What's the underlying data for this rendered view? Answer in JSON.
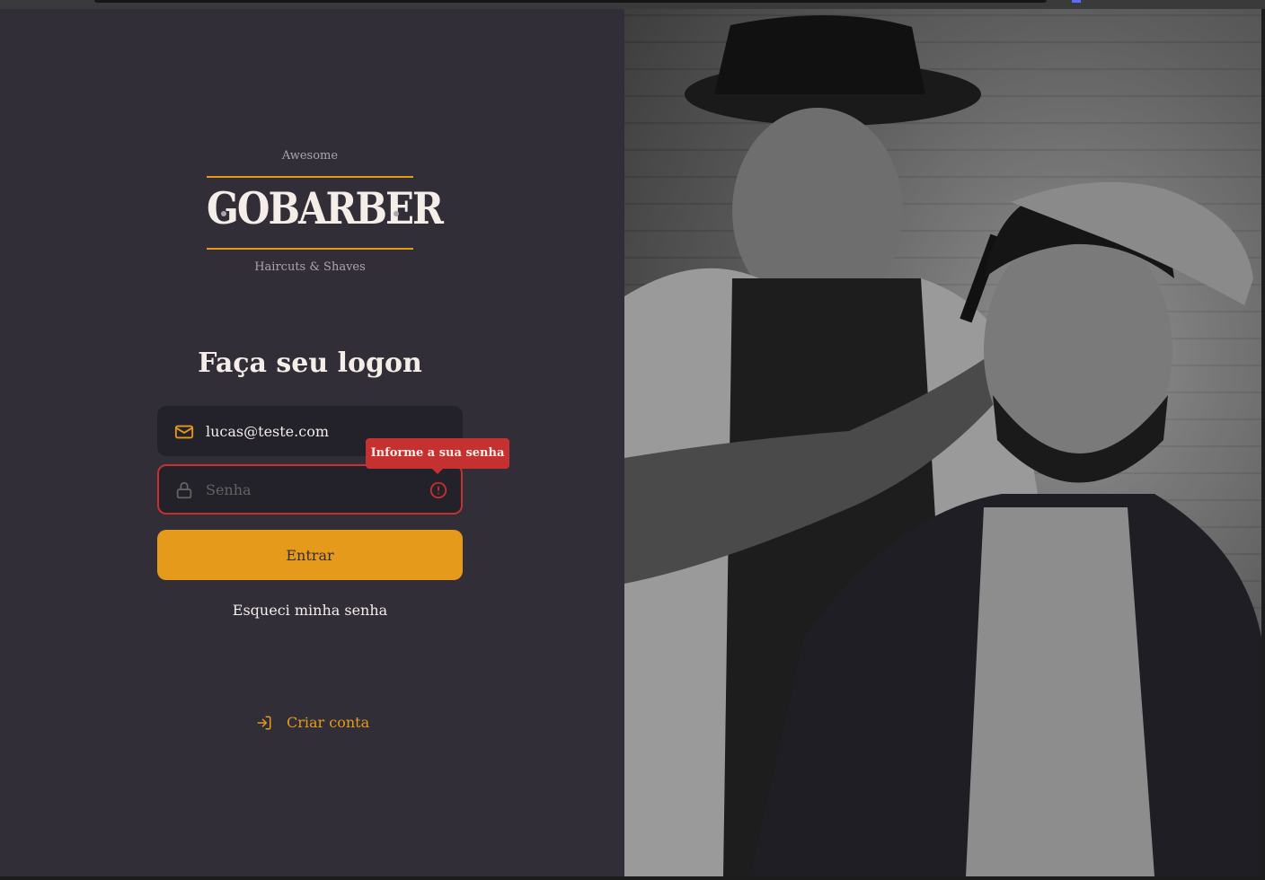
{
  "logo": {
    "top_text": "Awesome",
    "name": "GOBARBER",
    "bottom_text": "Haircuts & Shaves"
  },
  "form": {
    "title": "Faça seu logon",
    "email": {
      "value": "lucas@teste.com",
      "icon": "mail-icon"
    },
    "password": {
      "value": "",
      "placeholder": "Senha",
      "icon": "lock-icon",
      "error_icon": "alert-circle-icon"
    },
    "error_tooltip": "Informe a sua senha",
    "submit_label": "Entrar",
    "forgot_label": "Esqueci minha senha"
  },
  "create_account": {
    "label": "Criar conta",
    "icon": "log-in-icon"
  },
  "colors": {
    "background": "#312e38",
    "input_bg": "#232129",
    "accent": "#e69a1b",
    "error": "#c53030",
    "text": "#f4ede8",
    "muted": "#666360"
  }
}
